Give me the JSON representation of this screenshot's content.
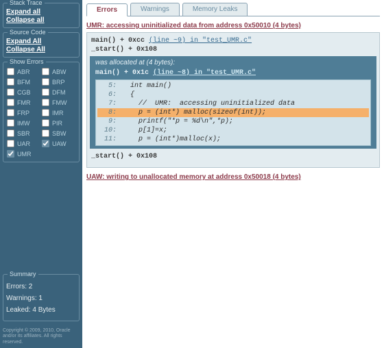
{
  "sidebar": {
    "stack_trace": {
      "legend": "Stack Trace",
      "expand": "Expand all",
      "collapse": "Collapse all"
    },
    "source_code": {
      "legend": "Source Code",
      "expand": "Expand All",
      "collapse": "Collapse All"
    },
    "show_errors": {
      "legend": "Show Errors",
      "items": [
        {
          "code": "ABR",
          "checked": false
        },
        {
          "code": "ABW",
          "checked": false
        },
        {
          "code": "BFM",
          "checked": false
        },
        {
          "code": "BRP",
          "checked": false
        },
        {
          "code": "CGB",
          "checked": false
        },
        {
          "code": "DFM",
          "checked": false
        },
        {
          "code": "FMR",
          "checked": false
        },
        {
          "code": "FMW",
          "checked": false
        },
        {
          "code": "FRP",
          "checked": false
        },
        {
          "code": "IMR",
          "checked": false
        },
        {
          "code": "IMW",
          "checked": false
        },
        {
          "code": "PIR",
          "checked": false
        },
        {
          "code": "SBR",
          "checked": false
        },
        {
          "code": "SBW",
          "checked": false
        },
        {
          "code": "UAR",
          "checked": false
        },
        {
          "code": "UAW",
          "checked": true
        },
        {
          "code": "UMR",
          "checked": true
        }
      ]
    },
    "summary": {
      "legend": "Summary",
      "errors": "Errors: 2",
      "warnings": "Warnings: 1",
      "leaked": "Leaked: 4 Bytes"
    },
    "copyright": "Copyright © 2009, 2010, Oracle and/or its affiliates. All rights reserved."
  },
  "tabs": {
    "errors": "Errors",
    "warnings": "Warnings",
    "leaks": "Memory Leaks"
  },
  "umr": {
    "title": "UMR: accessing uninitialized data from address 0x50010 (4 bytes)",
    "stack1": {
      "func": "main() + 0xcc",
      "loc": "(line ~9) in \"test_UMR.c\""
    },
    "stack2": {
      "func": "_start() + 0x108",
      "loc": ""
    },
    "alloc_msg": "was allocated at (4 bytes):",
    "alloc_stack": {
      "func": "main() + 0x1c",
      "loc": "(line ~8) in \"test_UMR.c\""
    },
    "code": [
      {
        "ln": "5:",
        "txt": "  int main()",
        "hl": false
      },
      {
        "ln": "6:",
        "txt": "  {",
        "hl": false
      },
      {
        "ln": "7:",
        "txt": "    //  UMR:  accessing uninitialized data",
        "hl": false
      },
      {
        "ln": "8:",
        "txt": "    p = (int*) malloc(sizeof(int));",
        "hl": true
      },
      {
        "ln": "9:",
        "txt": "    printf(\"*p = %d\\n\",*p);",
        "hl": false
      },
      {
        "ln": "10:",
        "txt": "    p[1]=x;",
        "hl": false
      },
      {
        "ln": "11:",
        "txt": "    p = (int*)malloc(x);",
        "hl": false
      }
    ],
    "after_stack": "_start() + 0x108"
  },
  "uaw": {
    "title": "UAW: writing to unallocated memory at address 0x50018 (4 bytes)"
  }
}
